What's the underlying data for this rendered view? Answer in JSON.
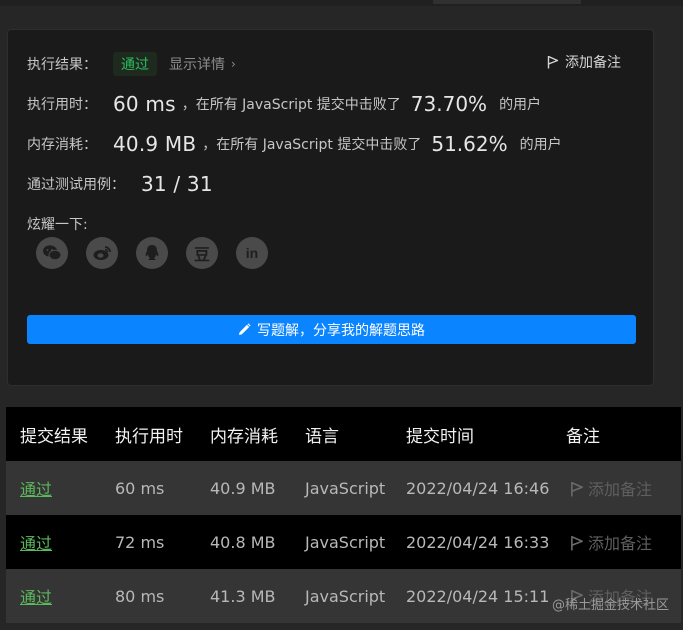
{
  "result_card": {
    "exec_result_label": "执行结果：",
    "pass_badge": "通过",
    "show_details": "显示详情",
    "add_note": "添加备注",
    "runtime": {
      "label": "执行用时：",
      "value": "60 ms",
      "middle_text": "，在所有 JavaScript 提交中击败了",
      "percent": "73.70%",
      "suffix": "的用户"
    },
    "memory": {
      "label": "内存消耗：",
      "value": "40.9 MB",
      "middle_text": "，在所有 JavaScript 提交中击败了",
      "percent": "51.62%",
      "suffix": "的用户"
    },
    "tests": {
      "label": "通过测试用例：",
      "value": "31 / 31"
    },
    "share_label": "炫耀一下:",
    "share_icons": [
      "wechat-icon",
      "weibo-icon",
      "qq-icon",
      "douban-icon",
      "linkedin-icon"
    ],
    "douban_glyph": "豆",
    "linkedin_glyph": "in",
    "write_button": "写题解，分享我的解题思路"
  },
  "table": {
    "headers": [
      "提交结果",
      "执行用时",
      "内存消耗",
      "语言",
      "提交时间",
      "备注"
    ],
    "rows": [
      {
        "status": "通过",
        "runtime": "60 ms",
        "memory": "40.9 MB",
        "language": "JavaScript",
        "time": "2022/04/24 16:46",
        "note": "添加备注"
      },
      {
        "status": "通过",
        "runtime": "72 ms",
        "memory": "40.8 MB",
        "language": "JavaScript",
        "time": "2022/04/24 16:33",
        "note": "添加备注"
      },
      {
        "status": "通过",
        "runtime": "80 ms",
        "memory": "41.3 MB",
        "language": "JavaScript",
        "time": "2022/04/24 15:11",
        "note": "添加备注"
      }
    ]
  },
  "watermark": "@稀土掘金技术社区",
  "colors": {
    "accent": "#0a84ff",
    "pass": "#2cbb5d",
    "table_pass": "#5cb85c",
    "background": "#262626",
    "card": "#1a1a1a"
  }
}
